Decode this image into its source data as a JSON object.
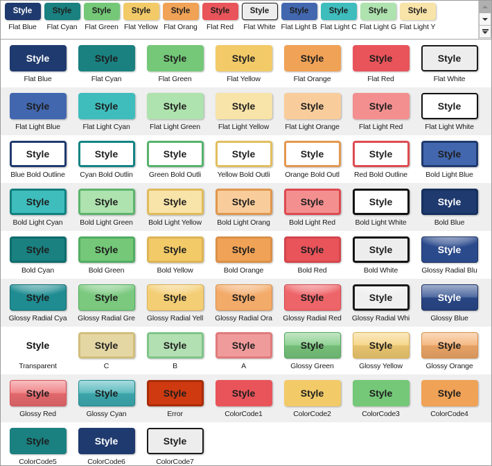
{
  "sample_label": "Style",
  "scrollbar": {
    "up_icon": "triangle-up-icon",
    "down_icon": "triangle-down-icon",
    "page_down_icon": "triangle-down-bar-icon",
    "up_disabled": true
  },
  "top_strip": {
    "items": [
      {
        "caption": "Flat Blue",
        "label": "Style",
        "fill": "#1F3A6E",
        "border": "#1F3A6E",
        "text": "#ffffff"
      },
      {
        "caption": "Flat Cyan",
        "label": "Style",
        "fill": "#1A8080",
        "border": "#1A8080",
        "text": "#1d1d1d"
      },
      {
        "caption": "Flat Green",
        "label": "Style",
        "fill": "#74C878",
        "border": "#74C878",
        "text": "#1d1d1d"
      },
      {
        "caption": "Flat Yellow",
        "label": "Style",
        "fill": "#F2CA68",
        "border": "#F2CA68",
        "text": "#1d1d1d"
      },
      {
        "caption": "Flat Orang",
        "label": "Style",
        "fill": "#F0A256",
        "border": "#F0A256",
        "text": "#1d1d1d"
      },
      {
        "caption": "Flat Red",
        "label": "Style",
        "fill": "#E8545A",
        "border": "#E8545A",
        "text": "#1d1d1d"
      },
      {
        "caption": "Flat White",
        "label": "Style",
        "fill": "#EDEDED",
        "border": "#1b1b1b",
        "text": "#1d1d1d"
      },
      {
        "caption": "Flat Light B",
        "label": "Style",
        "fill": "#4267AE",
        "border": "#4267AE",
        "text": "#1d1d1d"
      },
      {
        "caption": "Flat Light C",
        "label": "Style",
        "fill": "#3FBDBD",
        "border": "#3FBDBD",
        "text": "#1d1d1d"
      },
      {
        "caption": "Flat Light G",
        "label": "Style",
        "fill": "#AEE2AE",
        "border": "#AEE2AE",
        "text": "#1d1d1d"
      },
      {
        "caption": "Flat Light Y",
        "label": "Style",
        "fill": "#F8E3A8",
        "border": "#F8E3A8",
        "text": "#1d1d1d"
      }
    ]
  },
  "grid": {
    "rows": [
      {
        "shaded": false,
        "cells": [
          {
            "caption": "Flat Blue",
            "label": "Style",
            "fill": "#1F3A6E",
            "border": "#1F3A6E",
            "text": "#ffffff"
          },
          {
            "caption": "Flat Cyan",
            "label": "Style",
            "fill": "#1A8080",
            "border": "#1A8080",
            "text": "#1d1d1d"
          },
          {
            "caption": "Flat Green",
            "label": "Style",
            "fill": "#74C878",
            "border": "#74C878",
            "text": "#1d1d1d"
          },
          {
            "caption": "Flat Yellow",
            "label": "Style",
            "fill": "#F2CA68",
            "border": "#F2CA68",
            "text": "#1d1d1d"
          },
          {
            "caption": "Flat Orange",
            "label": "Style",
            "fill": "#F0A256",
            "border": "#F0A256",
            "text": "#1d1d1d"
          },
          {
            "caption": "Flat Red",
            "label": "Style",
            "fill": "#E8545A",
            "border": "#E8545A",
            "text": "#1d1d1d"
          },
          {
            "caption": "Flat White",
            "label": "Style",
            "fill": "#EDEDED",
            "border": "#1b1b1b",
            "text": "#1d1d1d",
            "border_width": 2
          }
        ]
      },
      {
        "shaded": true,
        "cells": [
          {
            "caption": "Flat Light Blue",
            "label": "Style",
            "fill": "#4267AE",
            "border": "#4267AE",
            "text": "#1d1d1d"
          },
          {
            "caption": "Flat Light Cyan",
            "label": "Style",
            "fill": "#3FBDBD",
            "border": "#3FBDBD",
            "text": "#1d1d1d"
          },
          {
            "caption": "Flat Light Green",
            "label": "Style",
            "fill": "#AEE2AE",
            "border": "#AEE2AE",
            "text": "#1d1d1d"
          },
          {
            "caption": "Flat Light Yellow",
            "label": "Style",
            "fill": "#F8E3A8",
            "border": "#F8E3A8",
            "text": "#1d1d1d"
          },
          {
            "caption": "Flat Light Orange",
            "label": "Style",
            "fill": "#F9CD9B",
            "border": "#F9CD9B",
            "text": "#1d1d1d"
          },
          {
            "caption": "Flat Light Red",
            "label": "Style",
            "fill": "#F3908F",
            "border": "#F3908F",
            "text": "#1d1d1d"
          },
          {
            "caption": "Flat Light White",
            "label": "Style",
            "fill": "#FFFFFF",
            "border": "#111111",
            "text": "#1d1d1d",
            "border_width": 2
          }
        ]
      },
      {
        "shaded": false,
        "cells": [
          {
            "caption": "Blue Bold Outline",
            "label": "Style",
            "fill": "#FFFFFF",
            "border": "#1F3A6E",
            "text": "#1d1d1d",
            "border_width": 3
          },
          {
            "caption": "Cyan Bold Outlin",
            "label": "Style",
            "fill": "#FFFFFF",
            "border": "#138383",
            "text": "#1d1d1d",
            "border_width": 3
          },
          {
            "caption": "Green Bold Outli",
            "label": "Style",
            "fill": "#FFFFFF",
            "border": "#56B36B",
            "text": "#1d1d1d",
            "border_width": 3
          },
          {
            "caption": "Yellow Bold Outli",
            "label": "Style",
            "fill": "#FFFFFF",
            "border": "#E3BE5E",
            "text": "#1d1d1d",
            "border_width": 3
          },
          {
            "caption": "Orange Bold Outl",
            "label": "Style",
            "fill": "#FFFFFF",
            "border": "#E3984F",
            "text": "#1d1d1d",
            "border_width": 3
          },
          {
            "caption": "Red Bold Outline",
            "label": "Style",
            "fill": "#FFFFFF",
            "border": "#DE4B51",
            "text": "#1d1d1d",
            "border_width": 3
          },
          {
            "caption": "Bold Light Blue",
            "label": "Style",
            "fill": "#4267AE",
            "border": "#1F3A6E",
            "text": "#1d1d1d",
            "border_width": 3
          }
        ]
      },
      {
        "shaded": true,
        "cells": [
          {
            "caption": "Bold Light Cyan",
            "label": "Style",
            "fill": "#3FBDBD",
            "border": "#117F7F",
            "text": "#1d1d1d",
            "border_width": 3
          },
          {
            "caption": "Bold Light Green",
            "label": "Style",
            "fill": "#AEE2AE",
            "border": "#5CB46C",
            "text": "#1d1d1d",
            "border_width": 3
          },
          {
            "caption": "Bold Light Yellow",
            "label": "Style",
            "fill": "#F8E3A8",
            "border": "#E0BB5C",
            "text": "#1d1d1d",
            "border_width": 3
          },
          {
            "caption": "Bold Light Orang",
            "label": "Style",
            "fill": "#F9CD9B",
            "border": "#E0964E",
            "text": "#1d1d1d",
            "border_width": 3
          },
          {
            "caption": "Bold Light Red",
            "label": "Style",
            "fill": "#F3908F",
            "border": "#DC4A50",
            "text": "#1d1d1d",
            "border_width": 3
          },
          {
            "caption": "Bold Light White",
            "label": "Style",
            "fill": "#FFFFFF",
            "border": "#111111",
            "text": "#1d1d1d",
            "border_width": 3
          },
          {
            "caption": "Bold Blue",
            "label": "Style",
            "fill": "#1F3A6E",
            "border": "#16305F",
            "text": "#ffffff",
            "border_width": 3
          }
        ]
      },
      {
        "shaded": false,
        "cells": [
          {
            "caption": "Bold Cyan",
            "label": "Style",
            "fill": "#1A8080",
            "border": "#0E6D6D",
            "text": "#1d1d1d",
            "border_width": 3
          },
          {
            "caption": "Bold Green",
            "label": "Style",
            "fill": "#74C878",
            "border": "#52AD63",
            "text": "#1d1d1d",
            "border_width": 3
          },
          {
            "caption": "Bold Yellow",
            "label": "Style",
            "fill": "#F2CA68",
            "border": "#DDB456",
            "text": "#1d1d1d",
            "border_width": 3
          },
          {
            "caption": "Bold Orange",
            "label": "Style",
            "fill": "#F0A256",
            "border": "#DB9048",
            "text": "#1d1d1d",
            "border_width": 3
          },
          {
            "caption": "Bold Red",
            "label": "Style",
            "fill": "#E8545A",
            "border": "#D4454C",
            "text": "#1d1d1d",
            "border_width": 3
          },
          {
            "caption": "Bold White",
            "label": "Style",
            "fill": "#EDEDED",
            "border": "#121212",
            "text": "#1d1d1d",
            "border_width": 3
          },
          {
            "caption": "Glossy Radial Blu",
            "label": "Style",
            "fill": "#2B4A8C",
            "border": "#1B3161",
            "text": "#ffffff",
            "gloss": "radial"
          }
        ]
      },
      {
        "shaded": true,
        "cells": [
          {
            "caption": "Glossy Radial Cya",
            "label": "Style",
            "fill": "#1E8C91",
            "border": "#0F6B70",
            "text": "#1d1d1d",
            "gloss": "radial"
          },
          {
            "caption": "Glossy Radial Gre",
            "label": "Style",
            "fill": "#7BC97F",
            "border": "#51AB5E",
            "text": "#1d1d1d",
            "gloss": "radial"
          },
          {
            "caption": "Glossy Radial Yell",
            "label": "Style",
            "fill": "#F4CE74",
            "border": "#DDB255",
            "text": "#1d1d1d",
            "gloss": "radial"
          },
          {
            "caption": "Glossy Radial Ora",
            "label": "Style",
            "fill": "#F3AB6A",
            "border": "#DA9048",
            "text": "#1d1d1d",
            "gloss": "radial"
          },
          {
            "caption": "Glossy Radial Red",
            "label": "Style",
            "fill": "#EE6569",
            "border": "#D4454C",
            "text": "#1d1d1d",
            "gloss": "radial"
          },
          {
            "caption": "Glossy Radial Whi",
            "label": "Style",
            "fill": "#F0F0F0",
            "border": "#1a1a1a",
            "text": "#1d1d1d",
            "gloss": "radial",
            "border_width": 3
          },
          {
            "caption": "Glossy Blue",
            "label": "Style",
            "fill": "#2B4A8C",
            "border": "#1B3161",
            "text": "#ffffff",
            "gloss": "linear"
          }
        ]
      },
      {
        "shaded": false,
        "cells": [
          {
            "caption": "Transparent",
            "label": "Style",
            "fill": "transparent",
            "border": "transparent",
            "text": "#111111",
            "flat": true
          },
          {
            "caption": "C",
            "label": "Style",
            "fill": "#E5D7A4",
            "border": "#D2BE7C",
            "text": "#1d1d1d",
            "border_width": 3
          },
          {
            "caption": "B",
            "label": "Style",
            "fill": "#B3E0B3",
            "border": "#7FC58A",
            "text": "#1d1d1d",
            "border_width": 3
          },
          {
            "caption": "A",
            "label": "Style",
            "fill": "#F09B9B",
            "border": "#E07B7B",
            "text": "#1d1d1d",
            "border_width": 3
          },
          {
            "caption": "Glossy Green",
            "label": "Style",
            "fill": "#7BC97F",
            "border": "#4FA85C",
            "text": "#1d1d1d",
            "gloss": "linear"
          },
          {
            "caption": "Glossy Yellow",
            "label": "Style",
            "fill": "#F4CE74",
            "border": "#DDB255",
            "text": "#1d1d1d",
            "gloss": "linear"
          },
          {
            "caption": "Glossy Orange",
            "label": "Style",
            "fill": "#F3AB6A",
            "border": "#DA9048",
            "text": "#1d1d1d",
            "gloss": "linear"
          }
        ]
      },
      {
        "shaded": true,
        "cells": [
          {
            "caption": "Glossy Red",
            "label": "Style",
            "fill": "#EE6E72",
            "border": "#D85056",
            "text": "#1d1d1d",
            "gloss": "linear"
          },
          {
            "caption": "Glossy Cyan",
            "label": "Style",
            "fill": "#3FAFB4",
            "border": "#1E8B92",
            "text": "#1d1d1d",
            "gloss": "linear"
          },
          {
            "caption": "Error",
            "label": "Style",
            "fill": "#D03A10",
            "border": "#A82C08",
            "text": "#1d1d1d",
            "border_width": 3
          },
          {
            "caption": "ColorCode1",
            "label": "Style",
            "fill": "#E8545A",
            "border": "#E8545A",
            "text": "#1d1d1d"
          },
          {
            "caption": "ColorCode2",
            "label": "Style",
            "fill": "#F2CA68",
            "border": "#F2CA68",
            "text": "#1d1d1d"
          },
          {
            "caption": "ColorCode3",
            "label": "Style",
            "fill": "#74C878",
            "border": "#74C878",
            "text": "#1d1d1d"
          },
          {
            "caption": "ColorCode4",
            "label": "Style",
            "fill": "#F0A256",
            "border": "#F0A256",
            "text": "#1d1d1d"
          }
        ]
      },
      {
        "shaded": false,
        "last": true,
        "cells": [
          {
            "caption": "ColorCode5",
            "label": "Style",
            "fill": "#1A8080",
            "border": "#1A8080",
            "text": "#1d1d1d"
          },
          {
            "caption": "ColorCode6",
            "label": "Style",
            "fill": "#1F3A6E",
            "border": "#1F3A6E",
            "text": "#ffffff"
          },
          {
            "caption": "ColorCode7",
            "label": "Style",
            "fill": "#EDEDED",
            "border": "#1b1b1b",
            "text": "#1d1d1d",
            "border_width": 2
          }
        ]
      }
    ]
  }
}
